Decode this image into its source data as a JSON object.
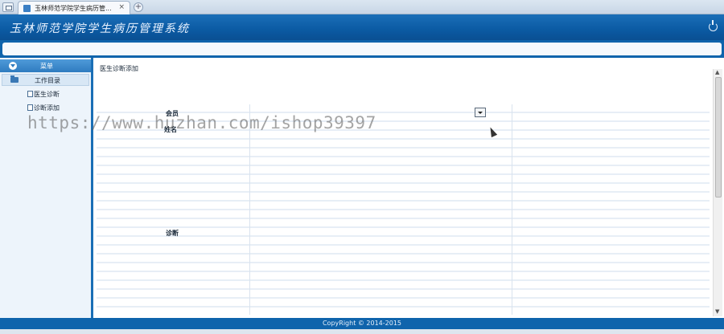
{
  "browser": {
    "tab_title": "玉林师范学院学生病历管...",
    "close_glyph": "×",
    "new_tab_glyph": "+"
  },
  "header": {
    "title": "玉林师范学院学生病历管理系统"
  },
  "sidebar": {
    "menu_title": "菜单",
    "group_label": "工作目录",
    "items": [
      {
        "label": "医生诊断"
      },
      {
        "label": "诊断添加"
      }
    ]
  },
  "content": {
    "page_title": "医生诊断添加",
    "fields": {
      "member_label": "会员",
      "name_label": "姓名",
      "diagnosis_label": "诊断"
    }
  },
  "watermark": "https://www.huzhan.com/ishop39397",
  "footer": {
    "copyright": "CopyRight © 2014-2015"
  },
  "colors": {
    "header_blue": "#0b5aa3",
    "sidebar_bg": "#edf4fb",
    "menu_head": "#2f7cc0"
  }
}
